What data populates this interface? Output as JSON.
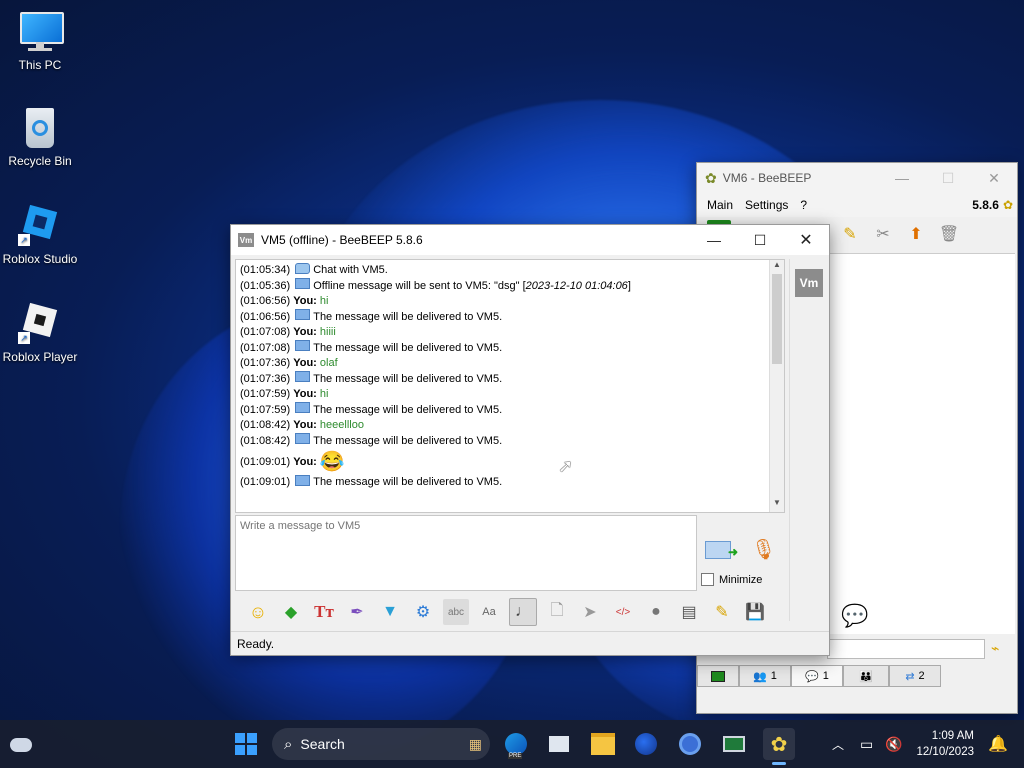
{
  "desktop": {
    "icons": [
      {
        "label": "This PC"
      },
      {
        "label": "Recycle Bin"
      },
      {
        "label": "Roblox Studio"
      },
      {
        "label": "Roblox Player"
      }
    ]
  },
  "vm6": {
    "title": "VM6 - BeeBEEP",
    "version": "5.8.6",
    "menu": [
      "Main",
      "Settings",
      "?"
    ],
    "tabs": [
      {
        "count": "1"
      },
      {
        "count": "1"
      },
      {
        "count": "2"
      }
    ]
  },
  "vm5": {
    "title": "VM5 (offline) - BeeBEEP 5.8.6",
    "badge": "Vm",
    "messages": [
      {
        "ts": "(01:05:34)",
        "icon": "chat-bubble-icon",
        "text": "Chat with VM5."
      },
      {
        "ts": "(01:05:36)",
        "icon": "envelope-icon",
        "text": "Offline message will be sent to VM5: \"dsg\" [",
        "italic": "2023-12-10 01:04:06",
        "tail": "]"
      },
      {
        "ts": "(01:06:56)",
        "you": "You:",
        "msg": "hi"
      },
      {
        "ts": "(01:06:56)",
        "icon": "envelope-icon",
        "text": "The message will be delivered to VM5."
      },
      {
        "ts": "(01:07:08)",
        "you": "You:",
        "msg": "hiiii"
      },
      {
        "ts": "(01:07:08)",
        "icon": "envelope-icon",
        "text": "The message will be delivered to VM5."
      },
      {
        "ts": "(01:07:36)",
        "you": "You:",
        "msg": "olaf"
      },
      {
        "ts": "(01:07:36)",
        "icon": "envelope-icon",
        "text": "The message will be delivered to VM5."
      },
      {
        "ts": "(01:07:59)",
        "you": "You:",
        "msg": "hi"
      },
      {
        "ts": "(01:07:59)",
        "icon": "envelope-icon",
        "text": "The message will be delivered to VM5."
      },
      {
        "ts": "(01:08:42)",
        "you": "You:",
        "msg": "heeellloo"
      },
      {
        "ts": "(01:08:42)",
        "icon": "envelope-icon",
        "text": "The message will be delivered to VM5."
      },
      {
        "ts": "(01:09:01)",
        "you": "You:",
        "emoji": "😂"
      },
      {
        "ts": "(01:09:01)",
        "icon": "envelope-icon",
        "text": "The message will be delivered to VM5."
      }
    ],
    "input_placeholder": "Write a message to VM5",
    "minimize_label": "Minimize",
    "status": "Ready."
  },
  "taskbar": {
    "search_label": "Search",
    "time": "1:09 AM",
    "date": "12/10/2023",
    "pre_badge": "PRE"
  },
  "colors": {
    "accent": "#0078d4",
    "message_green": "#2e8b2e",
    "taskbar": "#181e30"
  }
}
